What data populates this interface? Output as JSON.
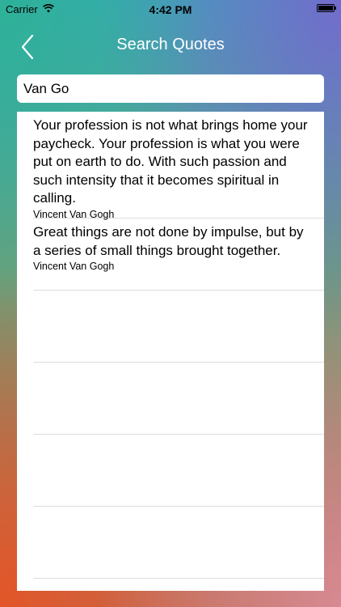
{
  "status_bar": {
    "carrier": "Carrier",
    "time": "4:42 PM",
    "battery_level": 1.0
  },
  "nav": {
    "title": "Search Quotes",
    "back_icon": "chevron-left-icon"
  },
  "search": {
    "value": "Van Go",
    "placeholder": ""
  },
  "quotes": [
    {
      "text": "Your profession is not what brings home your paycheck. Your profession is what you were put on earth to do. With such passion and such intensity that it becomes spiritual in calling.",
      "author": "Vincent Van Gogh"
    },
    {
      "text": "Great things are not done by impulse, but by a series of small things brought together.",
      "author": "Vincent Van Gogh"
    }
  ]
}
